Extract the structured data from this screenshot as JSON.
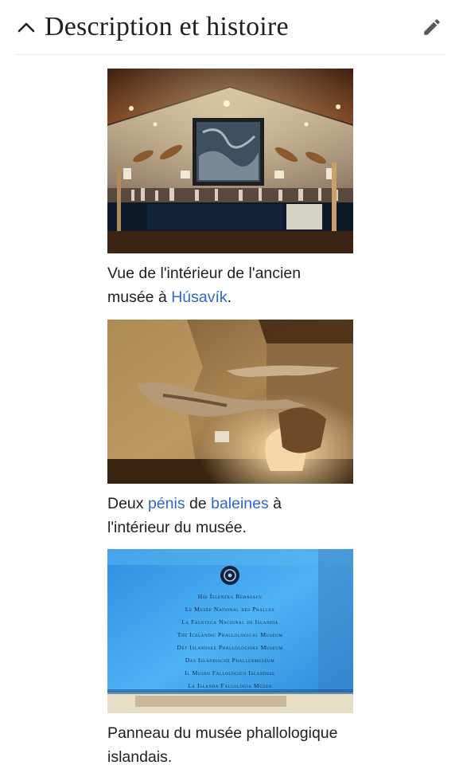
{
  "section": {
    "title": "Description et histoire",
    "collapse_icon": "chevron-up-icon",
    "edit_icon": "pencil-icon"
  },
  "figures": [
    {
      "image_description": "museum-interior-photo",
      "caption_before": "Vue de l'intérieur de l'ancien",
      "caption_line2_before": "musée à ",
      "caption_link": "Húsavík",
      "caption_after": "."
    },
    {
      "image_description": "whale-specimens-photo",
      "caption_before": "Deux ",
      "caption_link1": "pénis",
      "caption_middle": " de ",
      "caption_link2": "baleines",
      "caption_after": " à",
      "caption_line2": "l'intérieur du musée."
    },
    {
      "image_description": "museum-sign-photo",
      "caption_line1": "Panneau du musée phallologique",
      "caption_line2": "islandais.",
      "sign_lines": [
        "Hið Íslenzka Reðasafn",
        "Le Musée National des Phallus",
        "La Faloteca Nacional de Islandia",
        "The Icelandic Phallological Museum",
        "Det Islandske Phallologiske Museum",
        "Das Isländische Phallusmuseum",
        "Il Museo Fallologico Islandese",
        "La Islanda Faluslogia Muzeo"
      ]
    }
  ],
  "colors": {
    "link": "#3366cc",
    "text": "#202122",
    "divider": "#eaecf0",
    "icon": "#54595d"
  }
}
